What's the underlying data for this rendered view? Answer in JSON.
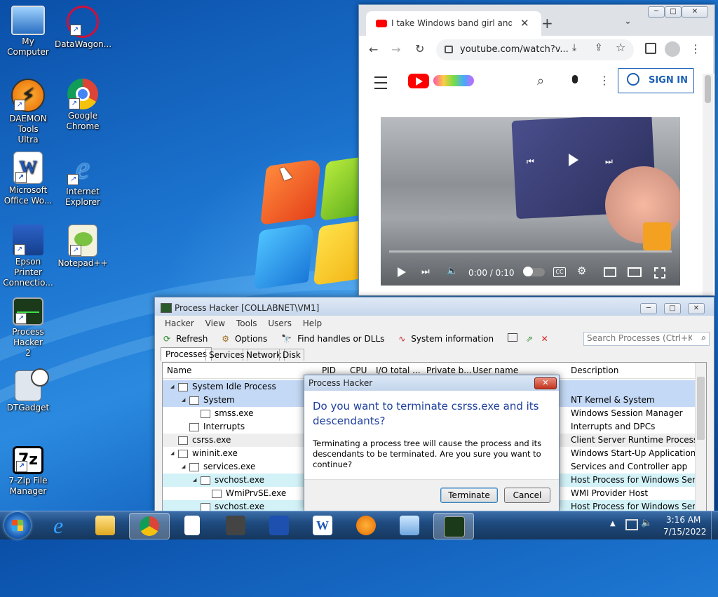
{
  "desktop": {
    "icons": [
      {
        "label": "My Computer"
      },
      {
        "label": "DataWagon..."
      },
      {
        "label": "DAEMON Tools Ultra"
      },
      {
        "label": "Google Chrome"
      },
      {
        "label": "Microsoft Office Wo..."
      },
      {
        "label": "Internet Explorer"
      },
      {
        "label": "Epson Printer Connectio..."
      },
      {
        "label": "Notepad++"
      },
      {
        "label": "Process Hacker 2"
      },
      {
        "label": "DTGadget"
      },
      {
        "label": "7-Zip File Manager"
      }
    ]
  },
  "chrome": {
    "tab_title": "I take Windows band girl and Wi",
    "url": "youtube.com/watch?v...",
    "sign_in": "SIGN IN",
    "time": "0:00 / 0:10",
    "cc": "CC",
    "progress": 0
  },
  "process_hacker": {
    "title": "Process Hacker [COLLABNET\\VM1]",
    "menu": [
      "Hacker",
      "View",
      "Tools",
      "Users",
      "Help"
    ],
    "toolbar": {
      "refresh": "Refresh",
      "options": "Options",
      "find": "Find handles or DLLs",
      "sysinfo": "System information"
    },
    "search_placeholder": "Search Processes (Ctrl+K)",
    "tabs": [
      "Processes",
      "Services",
      "Network",
      "Disk"
    ],
    "columns": [
      "Name",
      "PID",
      "CPU",
      "I/O total ...",
      "Private b...",
      "User name",
      "Description"
    ],
    "rows": [
      {
        "name": "System Idle Process",
        "desc": ""
      },
      {
        "name": "System",
        "desc": "NT Kernel & System"
      },
      {
        "name": "smss.exe",
        "desc": "Windows Session Manager"
      },
      {
        "name": "Interrupts",
        "desc": "Interrupts and DPCs"
      },
      {
        "name": "csrss.exe",
        "desc": "Client Server Runtime Process"
      },
      {
        "name": "wininit.exe",
        "desc": "Windows Start-Up Application"
      },
      {
        "name": "services.exe",
        "desc": "Services and Controller app"
      },
      {
        "name": "svchost.exe",
        "desc": "Host Process for Windows Ser..."
      },
      {
        "name": "WmiPrvSE.exe",
        "desc": "WMI Provider Host"
      },
      {
        "name": "svchost.exe",
        "desc": "Host Process for Windows Ser..."
      }
    ]
  },
  "dialog": {
    "title": "Process Hacker",
    "heading": "Do you want to terminate csrss.exe and its descendants?",
    "body": "Terminating a process tree will cause the process and its descendants to be terminated. Are you sure you want to continue?",
    "terminate": "Terminate",
    "cancel": "Cancel"
  },
  "taskbar": {
    "time": "3:16 AM",
    "date": "7/15/2022"
  },
  "colors": {
    "selected_row": "#c4d9f5",
    "service_row": "#d2f2f8",
    "youtube_red": "#ff0000",
    "link_blue": "#1a5fb4"
  }
}
